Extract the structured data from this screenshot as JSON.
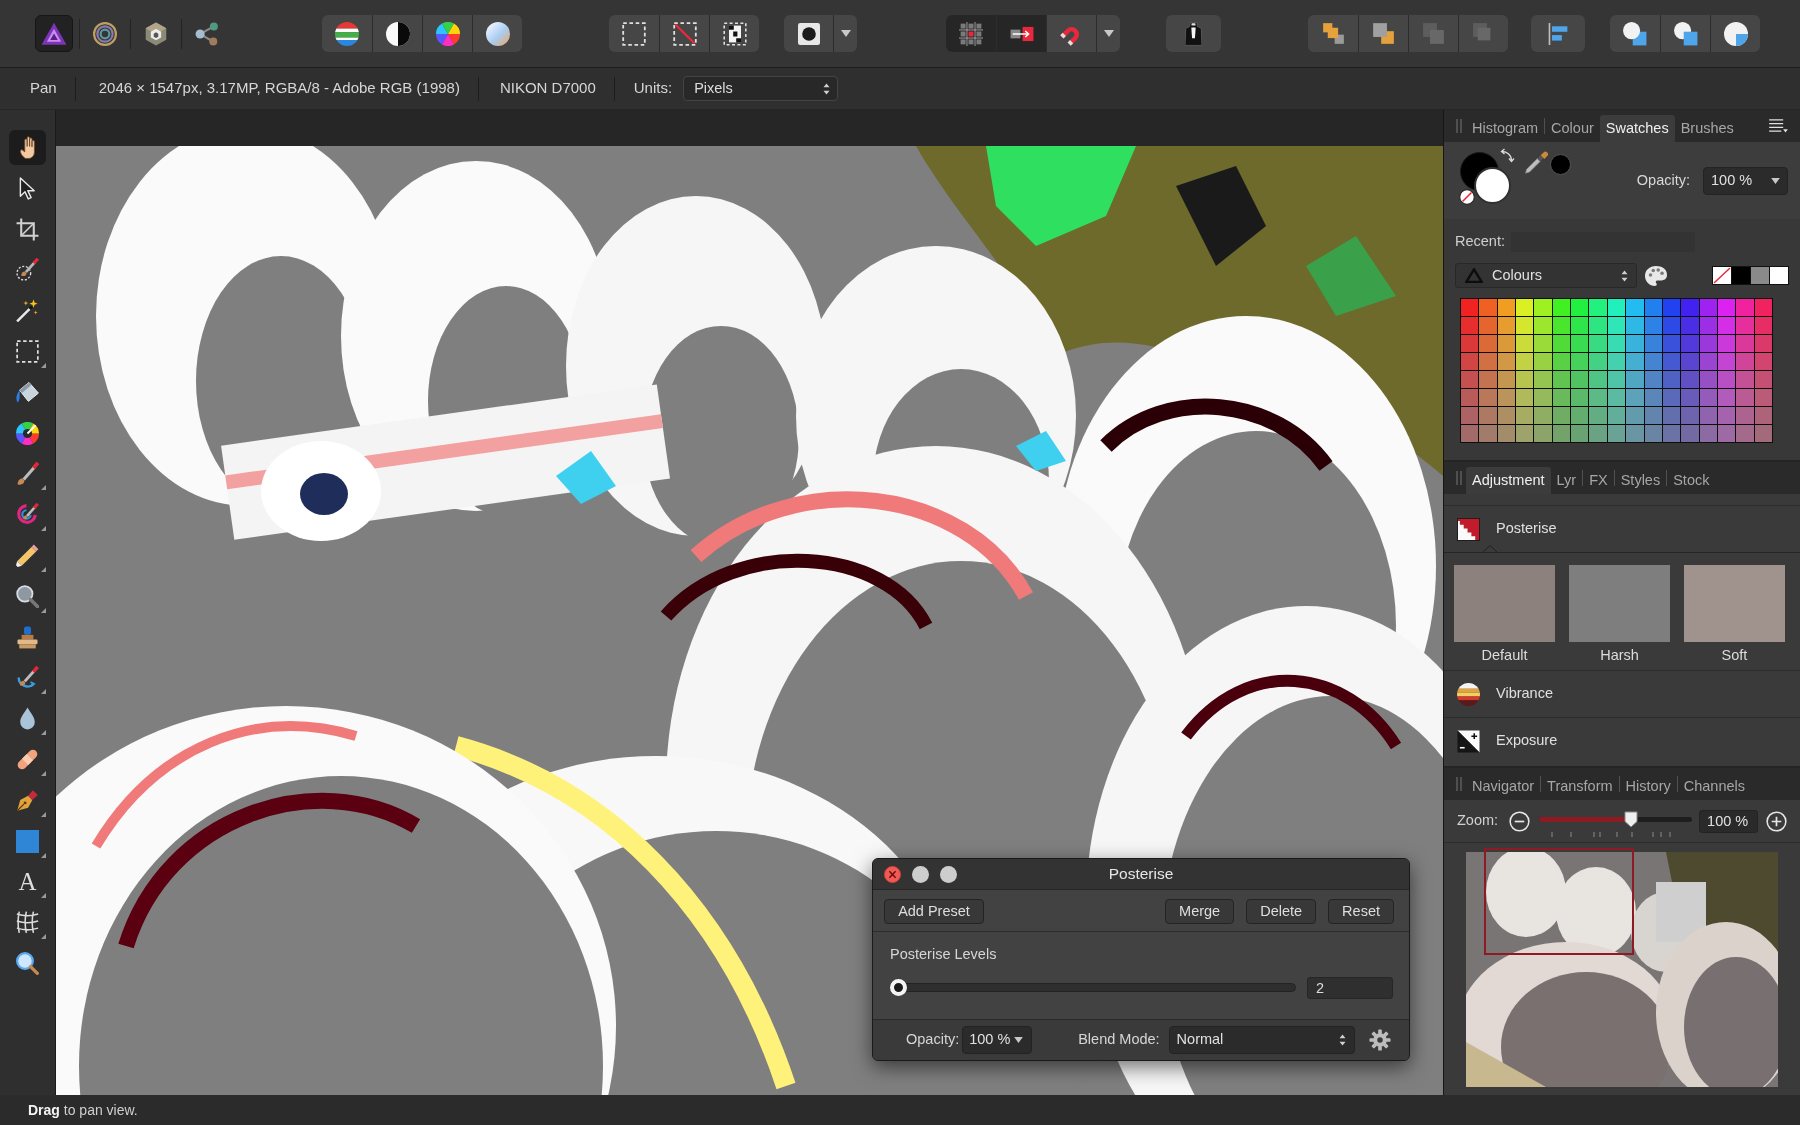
{
  "toolbar": {
    "personas": [
      {
        "kind": "photo",
        "selected": true
      },
      {
        "kind": "liquify",
        "selected": false
      },
      {
        "kind": "develop",
        "selected": false
      },
      {
        "kind": "export",
        "selected": false
      }
    ],
    "snapping": [
      {
        "kind": "grid",
        "on": true
      },
      {
        "kind": "pixel",
        "on": true
      },
      {
        "kind": "magnet",
        "on": false
      }
    ],
    "arrange": [
      {
        "kind": "front",
        "disabled": false
      },
      {
        "kind": "forward",
        "disabled": false
      },
      {
        "kind": "backward",
        "disabled": true
      },
      {
        "kind": "back",
        "disabled": true
      }
    ]
  },
  "context_bar": {
    "tool": "Pan",
    "document_info": "2046 × 1547px, 3.17MP, RGBA/8 - Adobe RGB (1998)",
    "camera": "NIKON D7000",
    "units_label": "Units:",
    "units_value": "Pixels"
  },
  "tools": [
    {
      "kind": "hand",
      "selected": true,
      "flyout": false
    },
    {
      "kind": "pointer",
      "selected": false,
      "flyout": false
    },
    {
      "kind": "crop",
      "selected": false,
      "flyout": false
    },
    {
      "kind": "selectionbrush",
      "selected": false,
      "flyout": false
    },
    {
      "kind": "wand",
      "selected": false,
      "flyout": false
    },
    {
      "kind": "marquee",
      "selected": false,
      "flyout": true
    },
    {
      "kind": "bucket",
      "selected": false,
      "flyout": false
    },
    {
      "kind": "wheel",
      "selected": false,
      "flyout": false
    },
    {
      "kind": "brush",
      "selected": false,
      "flyout": true
    },
    {
      "kind": "recolor",
      "selected": false,
      "flyout": true
    },
    {
      "kind": "eraser",
      "selected": false,
      "flyout": true
    },
    {
      "kind": "dodge",
      "selected": false,
      "flyout": true
    },
    {
      "kind": "stamp",
      "selected": false,
      "flyout": false
    },
    {
      "kind": "smudge",
      "selected": false,
      "flyout": true
    },
    {
      "kind": "blur",
      "selected": false,
      "flyout": true
    },
    {
      "kind": "patch",
      "selected": false,
      "flyout": true
    },
    {
      "kind": "pen",
      "selected": false,
      "flyout": true
    },
    {
      "kind": "rectangle",
      "selected": false,
      "flyout": true
    },
    {
      "kind": "text",
      "glyph": "A",
      "selected": false,
      "flyout": true
    },
    {
      "kind": "mesh",
      "selected": false,
      "flyout": true
    },
    {
      "kind": "zoom",
      "selected": false,
      "flyout": false
    }
  ],
  "studio": {
    "top_tabs": [
      {
        "label": "Histogram",
        "selected": false
      },
      {
        "label": "Colour",
        "selected": false
      },
      {
        "label": "Swatches",
        "selected": true
      },
      {
        "label": "Brushes",
        "selected": false
      }
    ],
    "colour": {
      "wells": [
        {
          "kind": "primary",
          "color": "#000000"
        },
        {
          "kind": "secondary",
          "color": "#ffffff"
        },
        {
          "kind": "picked",
          "color": "#000000"
        }
      ],
      "opacity_label": "Opacity:",
      "opacity_value": "100 %"
    },
    "recent_label": "Recent:",
    "palette_name": "Colours",
    "basic_swatches": [
      {
        "kind": "none"
      },
      {
        "kind": "color",
        "color": "#000000"
      },
      {
        "kind": "color",
        "color": "#8a8a8a"
      },
      {
        "kind": "color",
        "color": "#ffffff"
      }
    ],
    "swatches": [
      {
        "color": "#f02222"
      },
      {
        "color": "#f06022"
      },
      {
        "color": "#f09e22"
      },
      {
        "color": "#dbf022"
      },
      {
        "color": "#9ef022"
      },
      {
        "color": "#41f022"
      },
      {
        "color": "#22f041"
      },
      {
        "color": "#22f07f"
      },
      {
        "color": "#22f0bc"
      },
      {
        "color": "#22bcf0"
      },
      {
        "color": "#227ff0"
      },
      {
        "color": "#2241f0"
      },
      {
        "color": "#4122f0"
      },
      {
        "color": "#9e22f0"
      },
      {
        "color": "#db22f0"
      },
      {
        "color": "#f0229e"
      },
      {
        "color": "#f02260"
      },
      {
        "color": "#e62e2e"
      },
      {
        "color": "#e6652e"
      },
      {
        "color": "#e69c2e"
      },
      {
        "color": "#d4e62e"
      },
      {
        "color": "#9ce62e"
      },
      {
        "color": "#4ae62e"
      },
      {
        "color": "#2ee64a"
      },
      {
        "color": "#2ee681"
      },
      {
        "color": "#2ee6b8"
      },
      {
        "color": "#2eb8e6"
      },
      {
        "color": "#2e81e6"
      },
      {
        "color": "#2e4ae6"
      },
      {
        "color": "#4a2ee6"
      },
      {
        "color": "#9c2ee6"
      },
      {
        "color": "#d42ee6"
      },
      {
        "color": "#e62e9c"
      },
      {
        "color": "#e62e65"
      },
      {
        "color": "#db3939"
      },
      {
        "color": "#db6a39"
      },
      {
        "color": "#db9a39"
      },
      {
        "color": "#cbdb39"
      },
      {
        "color": "#9adb39"
      },
      {
        "color": "#51db39"
      },
      {
        "color": "#39db51"
      },
      {
        "color": "#39db82"
      },
      {
        "color": "#39dbb3"
      },
      {
        "color": "#39b3db"
      },
      {
        "color": "#3982db"
      },
      {
        "color": "#3951db"
      },
      {
        "color": "#5139db"
      },
      {
        "color": "#9a39db"
      },
      {
        "color": "#cb39db"
      },
      {
        "color": "#db399a"
      },
      {
        "color": "#db396a"
      },
      {
        "color": "#d14545"
      },
      {
        "color": "#d16f45"
      },
      {
        "color": "#d19945"
      },
      {
        "color": "#c3d145"
      },
      {
        "color": "#99d145"
      },
      {
        "color": "#5ad145"
      },
      {
        "color": "#45d15a"
      },
      {
        "color": "#45d184"
      },
      {
        "color": "#45d1ae"
      },
      {
        "color": "#45aed1"
      },
      {
        "color": "#4584d1"
      },
      {
        "color": "#455ad1"
      },
      {
        "color": "#5a45d1"
      },
      {
        "color": "#9945d1"
      },
      {
        "color": "#c345d1"
      },
      {
        "color": "#d14599"
      },
      {
        "color": "#d1456f"
      },
      {
        "color": "#c45050"
      },
      {
        "color": "#c47350"
      },
      {
        "color": "#c49650"
      },
      {
        "color": "#b8c450"
      },
      {
        "color": "#96c450"
      },
      {
        "color": "#61c450"
      },
      {
        "color": "#50c461"
      },
      {
        "color": "#50c484"
      },
      {
        "color": "#50c4a7"
      },
      {
        "color": "#50a7c4"
      },
      {
        "color": "#5084c4"
      },
      {
        "color": "#5061c4"
      },
      {
        "color": "#6150c4"
      },
      {
        "color": "#9650c4"
      },
      {
        "color": "#b850c4"
      },
      {
        "color": "#c45096"
      },
      {
        "color": "#c45073"
      },
      {
        "color": "#ba5b5b"
      },
      {
        "color": "#ba785b"
      },
      {
        "color": "#ba945b"
      },
      {
        "color": "#b1ba5b"
      },
      {
        "color": "#94ba5b"
      },
      {
        "color": "#69ba5b"
      },
      {
        "color": "#5bba69"
      },
      {
        "color": "#5bba86"
      },
      {
        "color": "#5bbaa2"
      },
      {
        "color": "#5ba2ba"
      },
      {
        "color": "#5b86ba"
      },
      {
        "color": "#5b69ba"
      },
      {
        "color": "#695bba"
      },
      {
        "color": "#945bba"
      },
      {
        "color": "#b15bba"
      },
      {
        "color": "#ba5b94"
      },
      {
        "color": "#ba5b78"
      },
      {
        "color": "#ad6363"
      },
      {
        "color": "#ad7963"
      },
      {
        "color": "#ad8f63"
      },
      {
        "color": "#a6ad63"
      },
      {
        "color": "#8fad63"
      },
      {
        "color": "#6ead63"
      },
      {
        "color": "#63ad6e"
      },
      {
        "color": "#63ad84"
      },
      {
        "color": "#63ad9b"
      },
      {
        "color": "#639bad"
      },
      {
        "color": "#6384ad"
      },
      {
        "color": "#636ead"
      },
      {
        "color": "#6e63ad"
      },
      {
        "color": "#8f63ad"
      },
      {
        "color": "#a663ad"
      },
      {
        "color": "#ad638f"
      },
      {
        "color": "#ad6379"
      },
      {
        "color": "#a36a6a"
      },
      {
        "color": "#a37b6a"
      },
      {
        "color": "#a38c6a"
      },
      {
        "color": "#9da36a"
      },
      {
        "color": "#8ca36a"
      },
      {
        "color": "#73a36a"
      },
      {
        "color": "#6aa373"
      },
      {
        "color": "#6aa384"
      },
      {
        "color": "#6aa395"
      },
      {
        "color": "#6a95a3"
      },
      {
        "color": "#6a84a3"
      },
      {
        "color": "#6a73a3"
      },
      {
        "color": "#736aa3"
      },
      {
        "color": "#8c6aa3"
      },
      {
        "color": "#9d6aa3"
      },
      {
        "color": "#a36a8c"
      },
      {
        "color": "#a36a7b"
      }
    ],
    "adjustment_tabs": [
      {
        "label": "Adjustment",
        "selected": true
      },
      {
        "label": "Lyr",
        "selected": false
      },
      {
        "label": "FX",
        "selected": false
      },
      {
        "label": "Styles",
        "selected": false
      },
      {
        "label": "Stock",
        "selected": false
      }
    ],
    "adjustments": [
      {
        "kind": "posterise",
        "label": "Posterise",
        "expanded": true,
        "presets": [
          {
            "label": "Default"
          },
          {
            "label": "Harsh"
          },
          {
            "label": "Soft"
          }
        ]
      },
      {
        "kind": "vibrance",
        "label": "Vibrance",
        "expanded": false
      },
      {
        "kind": "exposure",
        "label": "Exposure",
        "expanded": false
      }
    ],
    "navigator_tabs": [
      {
        "label": "Navigator",
        "selected": false
      },
      {
        "label": "Transform",
        "selected": false
      },
      {
        "label": "History",
        "selected": false
      },
      {
        "label": "Channels",
        "selected": false
      }
    ],
    "navigator": {
      "zoom_label": "Zoom:",
      "level": 0.61,
      "zoom_value": "100 %"
    }
  },
  "posterise_dialog": {
    "title": "Posterise",
    "window_buttons": [
      {
        "kind": "close",
        "disabled": false
      },
      {
        "kind": "minimize",
        "disabled": true
      },
      {
        "kind": "zoom",
        "disabled": true
      }
    ],
    "preset_button": "Add Preset",
    "buttons": [
      "Merge",
      "Delete",
      "Reset"
    ],
    "levels_label": "Posterise Levels",
    "level": 0,
    "levels_value": "2",
    "opacity_label": "Opacity:",
    "opacity_value": "100 %",
    "blend_label": "Blend Mode:",
    "blend_value": "Normal"
  },
  "status_bar": {
    "hint": "**Drag** to pan view."
  }
}
